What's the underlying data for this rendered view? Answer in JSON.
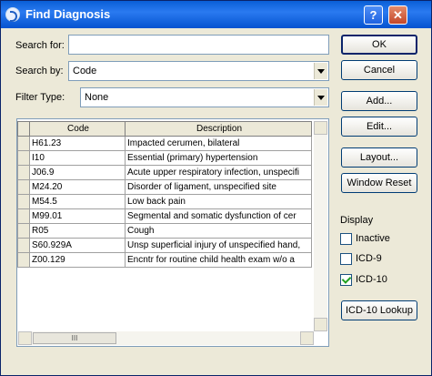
{
  "window": {
    "title": "Find Diagnosis",
    "help_label": "?",
    "close_label": "✕"
  },
  "search_for": {
    "label": "Search for:",
    "value": ""
  },
  "search_by": {
    "label": "Search by:",
    "value": "Code"
  },
  "filter_type": {
    "label": "Filter Type:",
    "value": "None"
  },
  "grid": {
    "columns": [
      "Code",
      "Description"
    ],
    "rows": [
      {
        "code": "H61.23",
        "description": "Impacted cerumen, bilateral"
      },
      {
        "code": "I10",
        "description": "Essential (primary) hypertension"
      },
      {
        "code": "J06.9",
        "description": "Acute upper respiratory infection, unspecifi"
      },
      {
        "code": "M24.20",
        "description": "Disorder of ligament, unspecified site"
      },
      {
        "code": "M54.5",
        "description": "Low back pain"
      },
      {
        "code": "M99.01",
        "description": "Segmental and somatic dysfunction of cer"
      },
      {
        "code": "R05",
        "description": "Cough"
      },
      {
        "code": "S60.929A",
        "description": "Unsp superficial injury of unspecified hand,"
      },
      {
        "code": "Z00.129",
        "description": "Encntr for routine child health exam w/o a"
      }
    ],
    "hscroll_grip": "III"
  },
  "buttons": {
    "ok": "OK",
    "cancel": "Cancel",
    "add": "Add...",
    "edit": "Edit...",
    "layout": "Layout...",
    "window_reset": "Window Reset",
    "icd10_lookup": "ICD-10 Lookup"
  },
  "display": {
    "label": "Display",
    "inactive": {
      "label": "Inactive",
      "checked": false
    },
    "icd9": {
      "label": "ICD-9",
      "checked": false
    },
    "icd10": {
      "label": "ICD-10",
      "checked": true
    }
  }
}
